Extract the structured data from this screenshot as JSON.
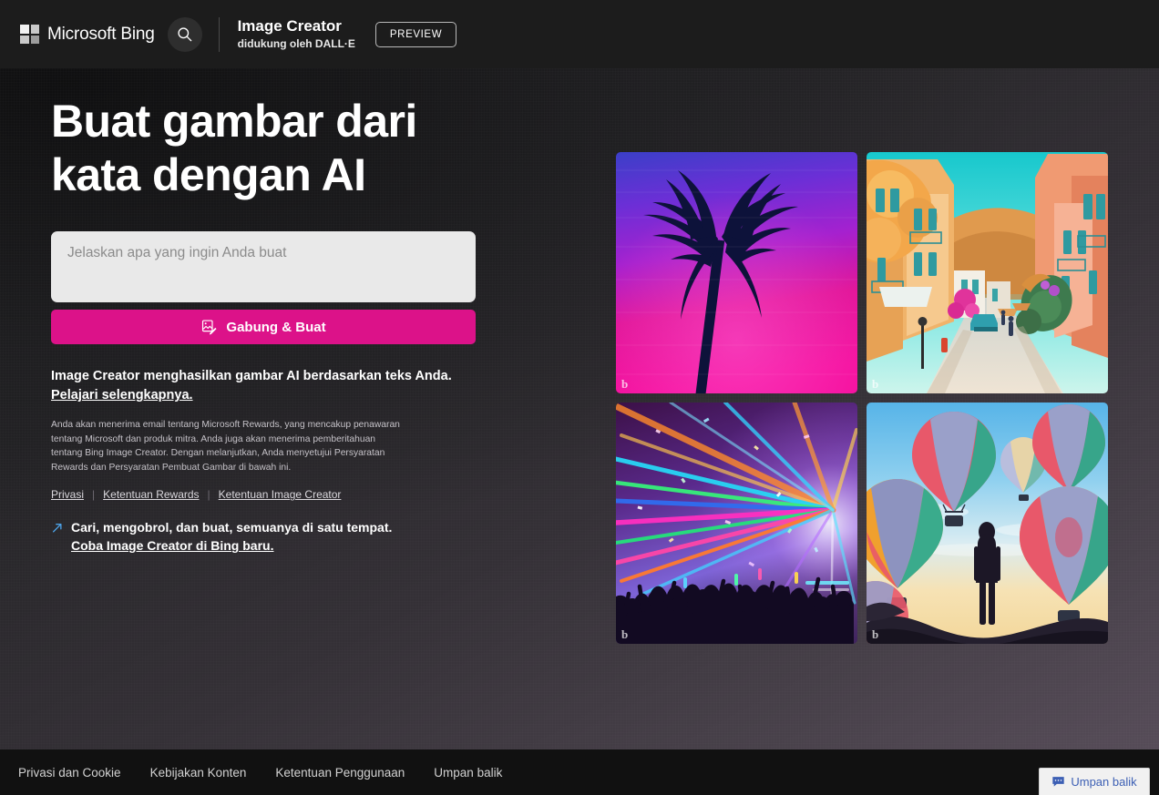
{
  "header": {
    "brand": "Microsoft Bing",
    "search_icon": "search-icon",
    "product_title": "Image Creator",
    "product_subtitle": "didukung oleh DALL·E",
    "preview_badge": "PREVIEW"
  },
  "hero": {
    "headline": "Buat gambar dari kata dengan AI",
    "prompt_placeholder": "Jelaskan apa yang ingin Anda buat",
    "prompt_value": "",
    "cta_label": "Gabung & Buat",
    "cta_icon": "image-edit-icon",
    "cta_color": "#dc1289",
    "disclaimer_lead": "Image Creator menghasilkan gambar AI berdasarkan teks Anda. ",
    "disclaimer_link": "Pelajari selengkapnya.",
    "legal_fine_print": "Anda akan menerima email tentang Microsoft Rewards, yang mencakup penawaran tentang Microsoft dan produk mitra. Anda juga akan menerima pemberitahuan tentang Bing Image Creator. Dengan melanjutkan, Anda menyetujui Persyaratan Rewards dan Persyaratan Pembuat Gambar di bawah ini.",
    "legal_links": [
      "Privasi",
      "Ketentuan Rewards",
      "Ketentuan Image Creator"
    ],
    "legal_separator": "|",
    "promo_icon": "diagonal-arrow-icon",
    "promo_line1": "Cari, mengobrol, dan buat, semuanya di satu tempat.",
    "promo_line2": "Coba Image Creator di Bing baru."
  },
  "gallery": {
    "watermark": "b",
    "tiles": [
      {
        "name": "tile-synthwave-palm",
        "caption": "Siluet pohon palem synthwave"
      },
      {
        "name": "tile-mediterranean-street",
        "caption": "Jalan kota Mediterania"
      },
      {
        "name": "tile-laser-concert",
        "caption": "Konser dengan sinar laser"
      },
      {
        "name": "tile-hot-air-balloons",
        "caption": "Balon udara panas"
      }
    ]
  },
  "footer": {
    "links": [
      "Privasi dan Cookie",
      "Kebijakan Konten",
      "Ketentuan Penggunaan",
      "Umpan balik"
    ],
    "feedback_button": "Umpan balik",
    "feedback_icon": "speech-bubble-icon"
  }
}
